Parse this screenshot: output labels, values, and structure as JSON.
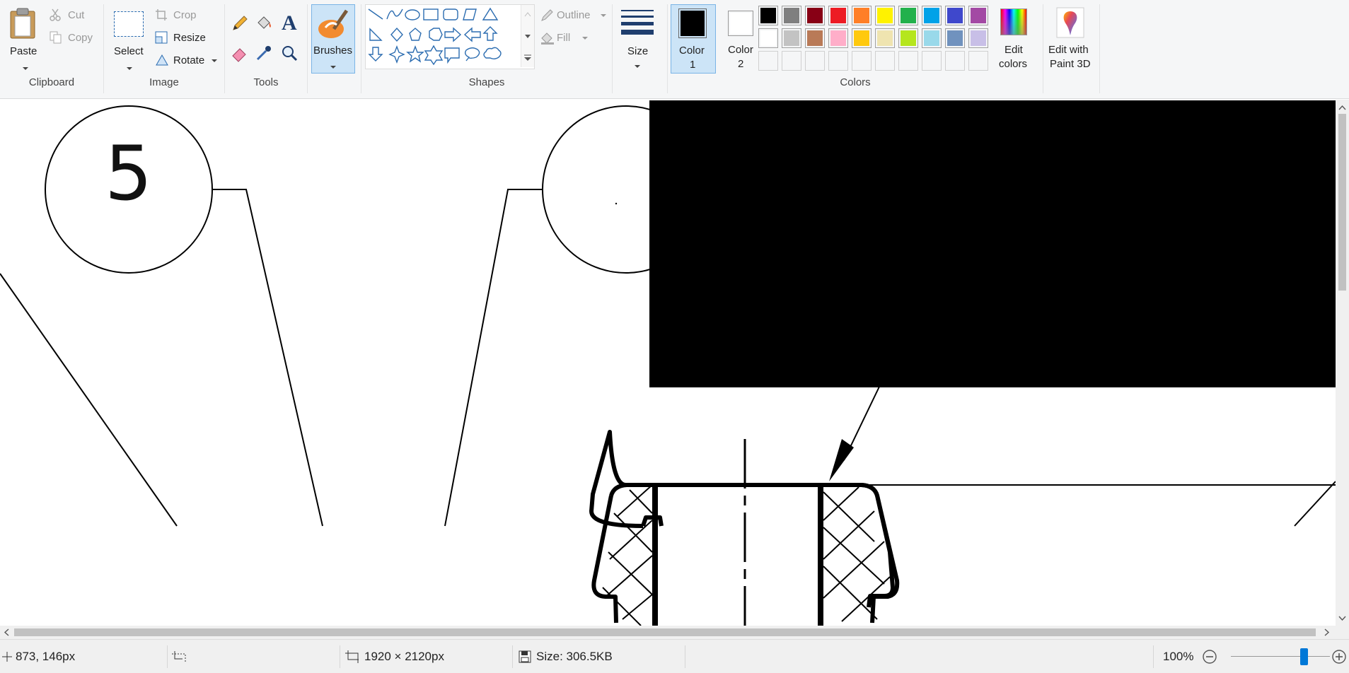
{
  "ribbon": {
    "clipboard": {
      "paste": "Paste",
      "cut": "Cut",
      "copy": "Copy",
      "group": "Clipboard"
    },
    "image": {
      "select": "Select",
      "crop": "Crop",
      "resize": "Resize",
      "rotate": "Rotate",
      "group": "Image"
    },
    "tools": {
      "group": "Tools",
      "text_glyph": "A"
    },
    "brushes": {
      "label": "Brushes"
    },
    "shapes": {
      "outline": "Outline",
      "fill": "Fill",
      "group": "Shapes"
    },
    "size": {
      "label": "Size"
    },
    "colors": {
      "color1_label": "Color",
      "color1_num": "1",
      "color2_label": "Color",
      "color2_num": "2",
      "edit_colors_1": "Edit",
      "edit_colors_2": "colors",
      "group": "Colors",
      "color1_value": "#000000",
      "color2_value": "#ffffff",
      "palette_row1": [
        "#000000",
        "#7f7f7f",
        "#880015",
        "#ed1c24",
        "#ff7f27",
        "#fff200",
        "#22b14c",
        "#00a2e8",
        "#3f48cc",
        "#a349a4"
      ],
      "palette_row2": [
        "#ffffff",
        "#c3c3c3",
        "#b97a57",
        "#ffaec9",
        "#ffc90e",
        "#efe4b0",
        "#b5e61d",
        "#99d9ea",
        "#7092be",
        "#c8bfe7"
      ]
    },
    "paint3d": {
      "line1": "Edit with",
      "line2": "Paint 3D"
    }
  },
  "canvas": {
    "balloon_number": "5"
  },
  "status": {
    "cursor_pos": "873, 146px",
    "image_dims": "1920 × 2120px",
    "file_size": "Size: 306.5KB",
    "zoom": "100%",
    "zoom_level": 1.0
  }
}
